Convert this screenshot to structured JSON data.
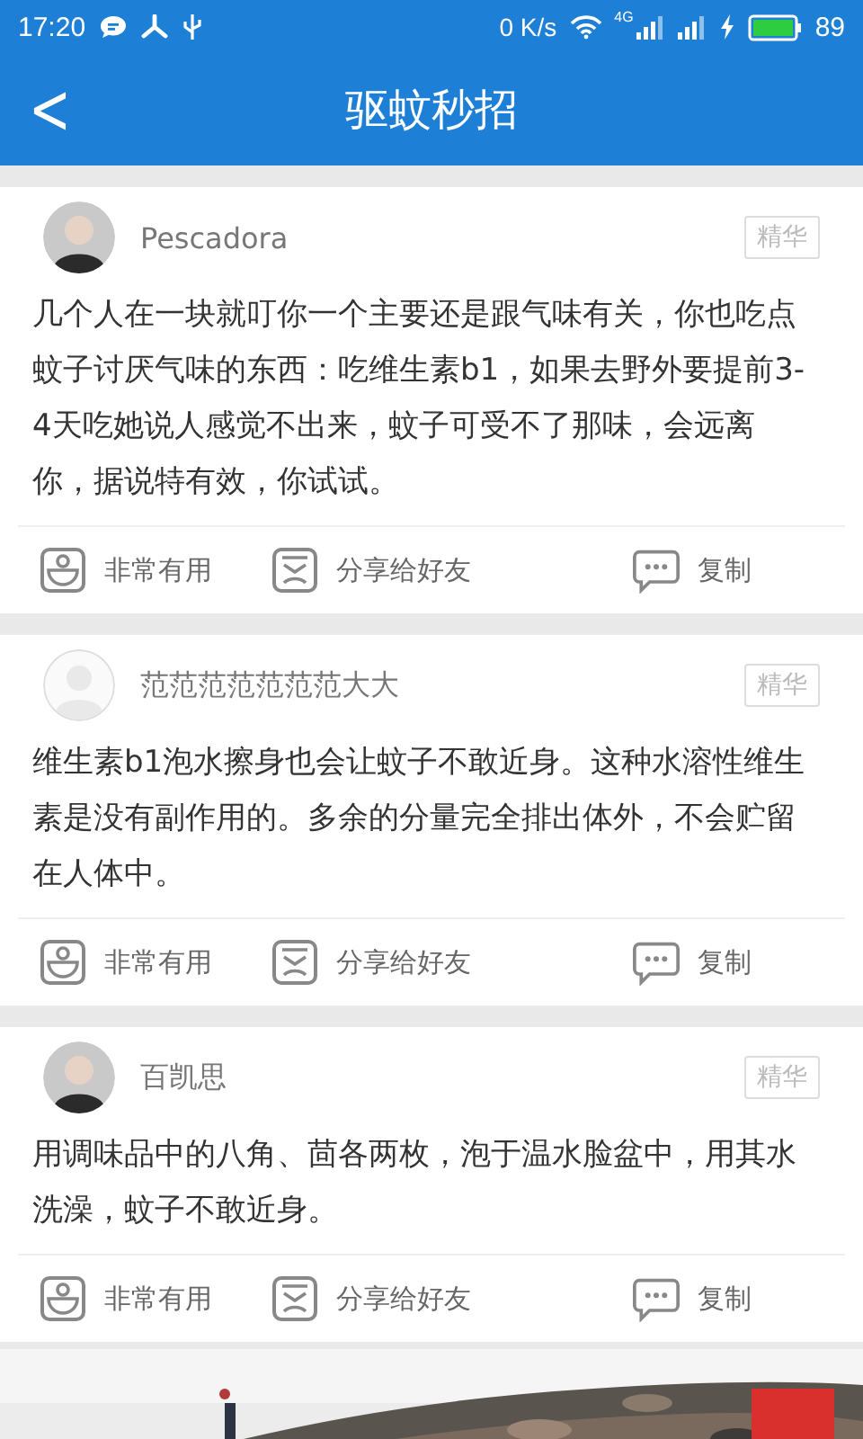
{
  "status_bar": {
    "time": "17:20",
    "speed": "0 K/s",
    "network": "4G",
    "battery": "89"
  },
  "header": {
    "title": "驱蚊秒招",
    "back": "<"
  },
  "posts": [
    {
      "user": "Pescadora",
      "badge": "精华",
      "body": "几个人在一块就叮你一个主要还是跟气味有关，你也吃点蚊子讨厌气味的东西：吃维生素b1，如果去野外要提前3-4天吃她说人感觉不出来，蚊子可受不了那味，会远离你，据说特有效，你试试。",
      "actions": [
        {
          "kind": "useful",
          "label": "非常有用"
        },
        {
          "kind": "share",
          "label": "分享给好友"
        },
        {
          "kind": "copy",
          "label": "复制"
        }
      ]
    },
    {
      "user": "范范范范范范范大大",
      "avatar": {
        "kind": "default"
      },
      "badge": "精华",
      "body": "维生素b1泡水擦身也会让蚊子不敢近身。这种水溶性维生素是没有副作用的。多余的分量完全排出体外，不会贮留在人体中。",
      "actions": [
        {
          "kind": "useful",
          "label": "非常有用"
        },
        {
          "kind": "share",
          "label": "分享给好友"
        },
        {
          "kind": "copy",
          "label": "复制"
        }
      ]
    },
    {
      "user": "百凯思",
      "badge": "精华",
      "body": "用调味品中的八角、茴各两枚，泡于温水脸盆中，用其水洗澡，蚊子不敢近身。",
      "actions": [
        {
          "kind": "useful",
          "label": "非常有用"
        },
        {
          "kind": "share",
          "label": "分享给好友"
        },
        {
          "kind": "copy",
          "label": "复制"
        }
      ]
    }
  ]
}
